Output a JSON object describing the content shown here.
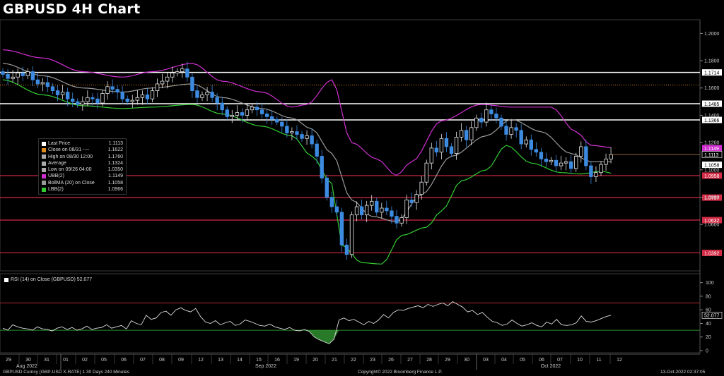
{
  "title": "GBPUSD 4H Chart",
  "colors": {
    "up": "#e6e6e6",
    "down": "#3d8be0",
    "ubb": "#d030d0",
    "lbb": "#33cc33",
    "ma": "#9a9a9a",
    "hline": "#ffffff",
    "support": "#d22b45",
    "close_level": "#e08a1e",
    "rsi": "#dcdcdc",
    "rsi_hi": "#b52a2a",
    "rsi_lo": "#2a8a2a"
  },
  "chart_data": [
    {
      "type": "candlestick",
      "title": "GBPUSD 4H Chart",
      "x_axis": {
        "day_ticks": [
          "29",
          "30",
          "31",
          "01",
          "02",
          "05",
          "06",
          "07",
          "08",
          "09",
          "12",
          "13",
          "14",
          "15",
          "16",
          "19",
          "20",
          "21",
          "22",
          "23",
          "26",
          "27",
          "28",
          "29",
          "30",
          "03",
          "04",
          "05",
          "06",
          "07",
          "10",
          "11",
          "12"
        ],
        "month_labels": [
          "Aug 2022",
          "Sep 2022",
          "Oct 2022"
        ]
      },
      "y_axis": {
        "range": [
          1.026,
          1.21
        ],
        "ticks": [
          "1.2000",
          "1.1800",
          "1.1600",
          "1.1400",
          "1.1200",
          "1.1000",
          "1.0800",
          "1.0600"
        ]
      },
      "closes": [
        1.17,
        1.167,
        1.168,
        1.171,
        1.169,
        1.172,
        1.166,
        1.163,
        1.164,
        1.161,
        1.158,
        1.155,
        1.157,
        1.152,
        1.15,
        1.148,
        1.15,
        1.153,
        1.152,
        1.149,
        1.156,
        1.161,
        1.159,
        1.157,
        1.152,
        1.15,
        1.151,
        1.153,
        1.155,
        1.152,
        1.158,
        1.163,
        1.165,
        1.168,
        1.171,
        1.172,
        1.174,
        1.168,
        1.158,
        1.153,
        1.155,
        1.157,
        1.153,
        1.149,
        1.144,
        1.139,
        1.14,
        1.142,
        1.14,
        1.144,
        1.146,
        1.144,
        1.141,
        1.139,
        1.137,
        1.135,
        1.132,
        1.127,
        1.128,
        1.126,
        1.123,
        1.125,
        1.119,
        1.11,
        1.094,
        1.08,
        1.073,
        1.069,
        1.045,
        1.038,
        1.067,
        1.073,
        1.067,
        1.074,
        1.077,
        1.069,
        1.072,
        1.07,
        1.066,
        1.061,
        1.065,
        1.078,
        1.076,
        1.082,
        1.091,
        1.105,
        1.116,
        1.113,
        1.123,
        1.117,
        1.112,
        1.124,
        1.129,
        1.122,
        1.131,
        1.138,
        1.135,
        1.144,
        1.141,
        1.138,
        1.132,
        1.126,
        1.131,
        1.129,
        1.119,
        1.122,
        1.115,
        1.113,
        1.108,
        1.106,
        1.107,
        1.103,
        1.105,
        1.106,
        1.101,
        1.11,
        1.117,
        1.103,
        1.095,
        1.098,
        1.104,
        1.108,
        1.1113
      ],
      "bands": {
        "ubb_anchor": [
          [
            0,
            1.188
          ],
          [
            8,
            1.182
          ],
          [
            16,
            1.172
          ],
          [
            24,
            1.168
          ],
          [
            30,
            1.172
          ],
          [
            38,
            1.178
          ],
          [
            44,
            1.165
          ],
          [
            52,
            1.157
          ],
          [
            58,
            1.146
          ],
          [
            61,
            1.148
          ],
          [
            66,
            1.166
          ],
          [
            70,
            1.12
          ],
          [
            75,
            1.108
          ],
          [
            79,
            1.096
          ],
          [
            82,
            1.106
          ],
          [
            88,
            1.136
          ],
          [
            96,
            1.148
          ],
          [
            102,
            1.146
          ],
          [
            110,
            1.146
          ],
          [
            115,
            1.128
          ],
          [
            118,
            1.118
          ],
          [
            123,
            1.116
          ]
        ],
        "lbb_anchor": [
          [
            0,
            1.166
          ],
          [
            8,
            1.155
          ],
          [
            16,
            1.147
          ],
          [
            24,
            1.145
          ],
          [
            30,
            1.146
          ],
          [
            38,
            1.148
          ],
          [
            44,
            1.141
          ],
          [
            52,
            1.132
          ],
          [
            58,
            1.125
          ],
          [
            62,
            1.11
          ],
          [
            66,
            1.09
          ],
          [
            68,
            1.045
          ],
          [
            72,
            1.032
          ],
          [
            76,
            1.031
          ],
          [
            80,
            1.052
          ],
          [
            85,
            1.058
          ],
          [
            88,
            1.07
          ],
          [
            92,
            1.092
          ],
          [
            97,
            1.1
          ],
          [
            101,
            1.118
          ],
          [
            106,
            1.105
          ],
          [
            112,
            1.098
          ],
          [
            116,
            1.097
          ],
          [
            120,
            1.099
          ],
          [
            123,
            1.097
          ]
        ],
        "ma_anchor": [
          [
            0,
            1.178
          ],
          [
            8,
            1.169
          ],
          [
            16,
            1.16
          ],
          [
            24,
            1.157
          ],
          [
            30,
            1.16
          ],
          [
            38,
            1.163
          ],
          [
            44,
            1.153
          ],
          [
            52,
            1.145
          ],
          [
            58,
            1.138
          ],
          [
            62,
            1.13
          ],
          [
            66,
            1.112
          ],
          [
            70,
            1.078
          ],
          [
            74,
            1.066
          ],
          [
            79,
            1.062
          ],
          [
            84,
            1.082
          ],
          [
            90,
            1.11
          ],
          [
            97,
            1.125
          ],
          [
            102,
            1.137
          ],
          [
            108,
            1.128
          ],
          [
            114,
            1.112
          ],
          [
            118,
            1.106
          ],
          [
            123,
            1.106
          ]
        ]
      },
      "horizontal_levels": [
        {
          "value": 1.1714,
          "label": "1.1714",
          "style": "resistance"
        },
        {
          "value": 1.1485,
          "label": "1.1485",
          "style": "resistance"
        },
        {
          "value": 1.1366,
          "label": "1.1366",
          "style": "resistance"
        },
        {
          "value": 1.0958,
          "label": "1.0958",
          "style": "support"
        },
        {
          "value": 1.0797,
          "label": "1.0797",
          "style": "support"
        },
        {
          "value": 1.0632,
          "label": "1.0632",
          "style": "support"
        },
        {
          "value": 1.0392,
          "label": "1.0392",
          "style": "support"
        },
        {
          "value": 1.1622,
          "label": "",
          "style": "close_level"
        }
      ],
      "price_tags": [
        {
          "value": 1.1149,
          "label": "1.1149",
          "kind": "ubb"
        },
        {
          "value": 1.1113,
          "label": "1.1113",
          "kind": "last"
        },
        {
          "value": 1.1058,
          "label": "1.1058",
          "kind": "ma"
        }
      ],
      "legend": [
        {
          "label": "Last Price",
          "value": "1.1113",
          "color": "#ffffff"
        },
        {
          "label": "Close on 08/31 ----",
          "value": "1.1622",
          "color": "#e08a1e"
        },
        {
          "label": "High on 08/30 12:00",
          "value": "1.1760",
          "color": "#aaaaaa"
        },
        {
          "label": "Average",
          "value": "1.1324",
          "color": "#aaaaaa"
        },
        {
          "label": "Low on 09/26 04:00",
          "value": "1.0350",
          "color": "#aaaaaa"
        },
        {
          "label": "UBB(2)",
          "value": "1.1149",
          "color": "#d030d0"
        },
        {
          "label": "BollMA (20)  on Close",
          "value": "1.1058",
          "color": "#9a9a9a"
        },
        {
          "label": "LBB(2)",
          "value": "1.0966",
          "color": "#33cc33"
        }
      ]
    },
    {
      "type": "line",
      "title": "RSI (14)  on Close (GBPUSD)  52.077",
      "y_axis": {
        "range": [
          0,
          110
        ],
        "ticks": [
          "100",
          "80",
          "60",
          "40",
          "20",
          "0"
        ]
      },
      "upper_level": 70,
      "lower_level": 30,
      "last_value": "52.077",
      "values": [
        33,
        30,
        38,
        35,
        33,
        32,
        30,
        35,
        32,
        31,
        29,
        33,
        35,
        31,
        34,
        30,
        32,
        36,
        31,
        33,
        34,
        38,
        33,
        35,
        37,
        32,
        44,
        40,
        38,
        52,
        46,
        48,
        56,
        58,
        52,
        60,
        63,
        59,
        57,
        62,
        50,
        42,
        40,
        44,
        38,
        41,
        43,
        37,
        39,
        45,
        43,
        40,
        37,
        36,
        39,
        35,
        33,
        31,
        34,
        30,
        29,
        31,
        28,
        20,
        16,
        13,
        10,
        17,
        45,
        48,
        44,
        46,
        42,
        38,
        43,
        40,
        45,
        53,
        48,
        56,
        60,
        59,
        62,
        64,
        66,
        63,
        68,
        65,
        68,
        70,
        66,
        72,
        68,
        64,
        57,
        59,
        53,
        56,
        49,
        43,
        41,
        37,
        39,
        45,
        40,
        36,
        38,
        41,
        37,
        35,
        42,
        39,
        46,
        38,
        37,
        38,
        41,
        51,
        43,
        42,
        44,
        47,
        50,
        52.077
      ]
    }
  ],
  "rsi_legend": "RSI (14)  on Close (GBPUSD) 52.077",
  "footer": {
    "left": "GBPUSD Curncy (GBP-USD X-RATE) 1 30 Days 240 Minutes",
    "center": "Copyright© 2022 Bloomberg Finance L.P.",
    "right": "13-Oct-2022 02:37:05"
  }
}
